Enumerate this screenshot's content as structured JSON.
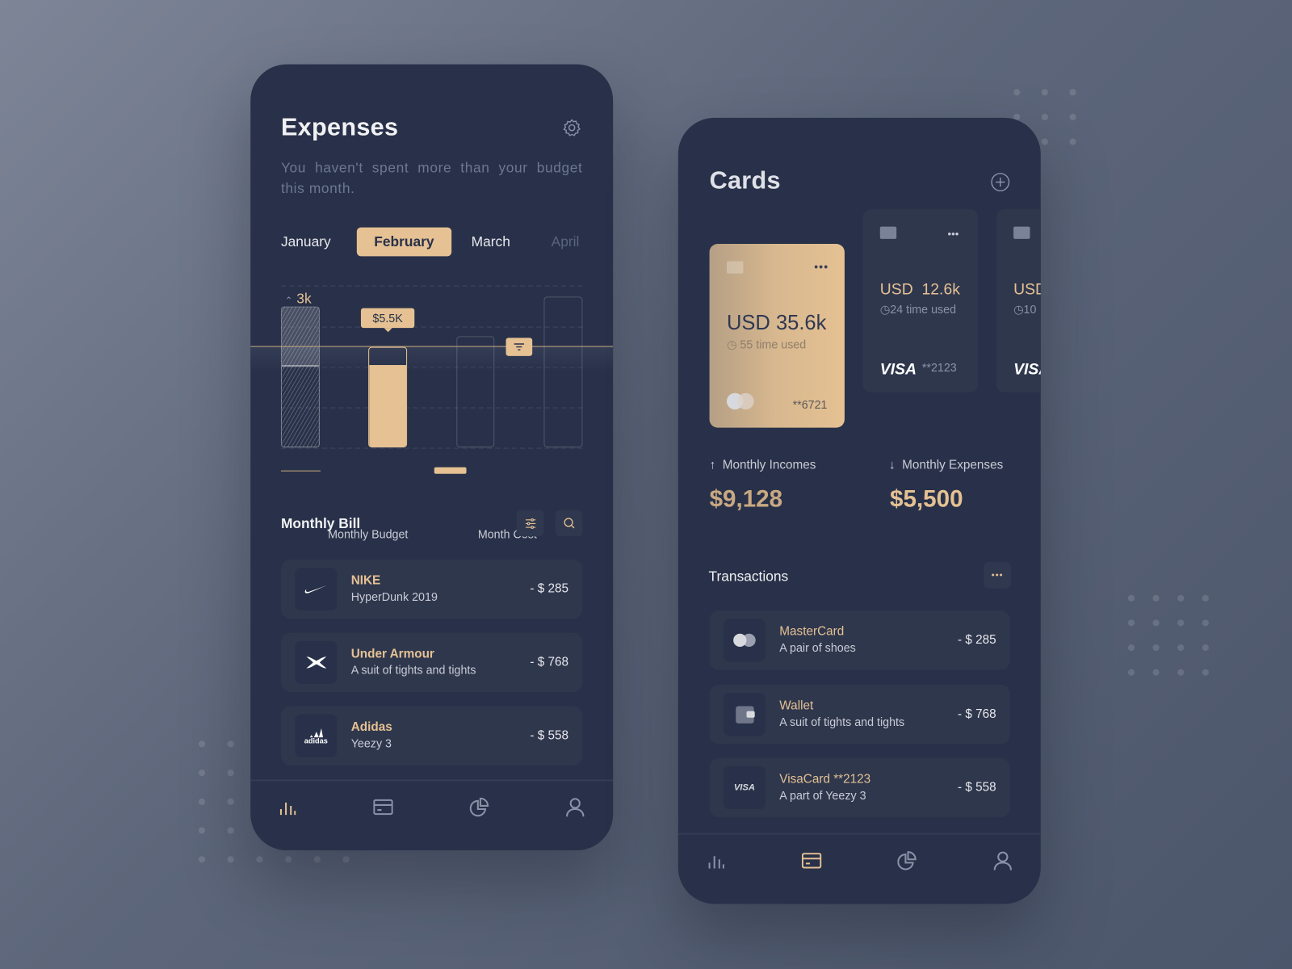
{
  "colors": {
    "accent": "#e5c193",
    "phone_bg": "#283149",
    "item_bg": "#2f374d"
  },
  "expenses": {
    "title": "Expenses",
    "subtitle": "You haven't spent more than your budget this month.",
    "settings_icon": "gear-icon",
    "months": [
      "January",
      "February",
      "March",
      "April"
    ],
    "selected_month": "February",
    "chart": {
      "over_budget_label": "3k",
      "tooltip": "$5.5K",
      "legend": {
        "budget": "Monthly Budget",
        "cost": "Month Cost"
      }
    },
    "bill": {
      "title": "Monthly Bill",
      "items": [
        {
          "name": "NIKE",
          "desc": "HyperDunk 2019",
          "amount": "- $ 285",
          "icon": "nike-logo"
        },
        {
          "name": "Under Armour",
          "desc": "A suit of tights and tights",
          "amount": "- $ 768",
          "icon": "under-armour-logo"
        },
        {
          "name": "Adidas",
          "desc": "Yeezy 3",
          "amount": "- $ 558",
          "icon": "adidas-logo",
          "logo_text": "adidas"
        }
      ]
    },
    "nav": {
      "active": "stats"
    }
  },
  "cards": {
    "title": "Cards",
    "list": [
      {
        "amount": "USD 35.6k",
        "used": "55 time used",
        "number": "**6721",
        "brand": "mastercard"
      },
      {
        "amount": "USD  12.6k",
        "used": "24 time used",
        "number": "**2123",
        "brand": "VISA"
      },
      {
        "amount": "USD",
        "used": "10",
        "brand": "VISA"
      }
    ],
    "incomes": {
      "label": "Monthly Incomes",
      "value": "$9,128"
    },
    "expenses": {
      "label": "Monthly Expenses",
      "value": "$5,500"
    },
    "transactions": {
      "title": "Transactions",
      "items": [
        {
          "name": "MasterCard",
          "desc": "A pair of shoes",
          "amount": "- $ 285",
          "icon": "mastercard-icon"
        },
        {
          "name": "Wallet",
          "desc": "A suit of tights and tights",
          "amount": "- $ 768",
          "icon": "wallet-icon"
        },
        {
          "name": "VisaCard **2123",
          "desc": "A part of Yeezy 3",
          "amount": "- $ 558",
          "icon": "visa-icon",
          "logo_text": "VISA"
        }
      ]
    },
    "nav": {
      "active": "cards"
    }
  }
}
